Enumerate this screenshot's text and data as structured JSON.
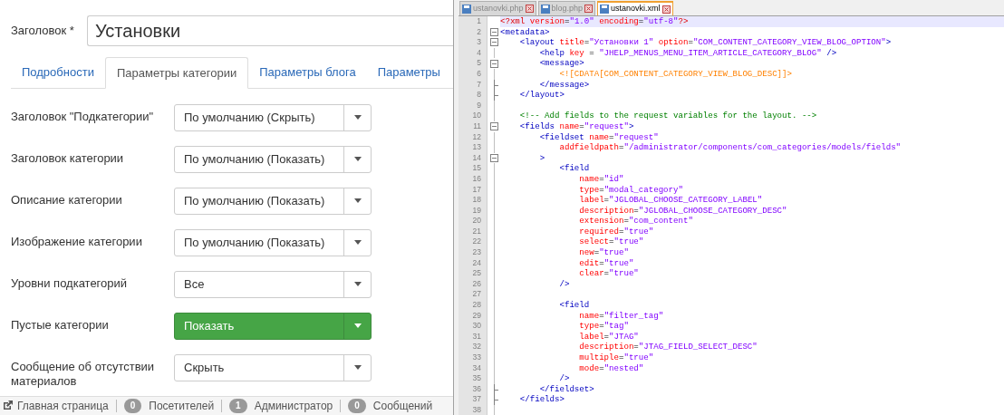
{
  "form": {
    "title_label": "Заголовок *",
    "title_value": "Установки",
    "tabs": [
      {
        "label": "Подробности",
        "selected": false
      },
      {
        "label": "Параметры категории",
        "selected": true
      },
      {
        "label": "Параметры блога",
        "selected": false
      },
      {
        "label": "Параметры",
        "selected": false
      }
    ],
    "rows": [
      {
        "label": "Заголовок \"Подкатегории\"",
        "value": "По умолчанию (Скрыть)",
        "success": false
      },
      {
        "label": "Заголовок категории",
        "value": "По умолчанию (Показать)",
        "success": false
      },
      {
        "label": "Описание категории",
        "value": "По умолчанию (Показать)",
        "success": false
      },
      {
        "label": "Изображение категории",
        "value": "По умолчанию (Показать)",
        "success": false
      },
      {
        "label": "Уровни подкатегорий",
        "value": "Все",
        "success": false
      },
      {
        "label": "Пустые категории",
        "value": "Показать",
        "success": true
      },
      {
        "label": "Сообщение об отсутствии материалов",
        "value": "Скрыть",
        "success": false
      }
    ]
  },
  "status_bar": {
    "home_link": "Главная страница",
    "items": [
      {
        "count": "0",
        "label": "Посетителей"
      },
      {
        "count": "1",
        "label": "Администратор"
      },
      {
        "count": "0",
        "label": "Сообщений"
      }
    ]
  },
  "editor": {
    "tabs": [
      {
        "label": "ustanovki.php",
        "selected": false
      },
      {
        "label": "blog.php",
        "selected": false
      },
      {
        "label": "ustanovki.xml",
        "selected": true
      }
    ],
    "lines": [
      {
        "number": "1",
        "current": true,
        "kind": "top",
        "tokens": [
          {
            "kind": "decl",
            "text": "<?xml "
          },
          {
            "kind": "attribute",
            "text": "version"
          },
          {
            "kind": "punct",
            "text": "="
          },
          {
            "kind": "value",
            "text": "\"1.0\" "
          },
          {
            "kind": "attribute",
            "text": "encoding"
          },
          {
            "kind": "punct",
            "text": "="
          },
          {
            "kind": "value",
            "text": "\"utf-8\""
          },
          {
            "kind": "decl",
            "text": "?>"
          }
        ]
      },
      {
        "number": "2",
        "current": false,
        "kind": "open",
        "tokens": [
          {
            "kind": "tag",
            "text": "<metadata>"
          }
        ]
      },
      {
        "number": "3",
        "current": false,
        "kind": "open",
        "tokens": [
          {
            "kind": "tag",
            "text": "    <layout "
          },
          {
            "kind": "attribute",
            "text": "title"
          },
          {
            "kind": "punct",
            "text": "="
          },
          {
            "kind": "value",
            "text": "\"Установки 1\" "
          },
          {
            "kind": "attribute",
            "text": "option"
          },
          {
            "kind": "punct",
            "text": "="
          },
          {
            "kind": "value",
            "text": "\"COM_CONTENT_CATEGORY_VIEW_BLOG_OPTION\""
          },
          {
            "kind": "tag",
            "text": ">"
          }
        ]
      },
      {
        "number": "4",
        "current": false,
        "kind": "inside",
        "tokens": [
          {
            "kind": "tag",
            "text": "        <help "
          },
          {
            "kind": "attribute",
            "text": "key"
          },
          {
            "kind": "punct",
            "text": " = "
          },
          {
            "kind": "value",
            "text": "\"JHELP_MENUS_MENU_ITEM_ARTICLE_CATEGORY_BLOG\""
          },
          {
            "kind": "tag",
            "text": " />"
          }
        ]
      },
      {
        "number": "5",
        "current": false,
        "kind": "open",
        "tokens": [
          {
            "kind": "tag",
            "text": "        <message>"
          }
        ]
      },
      {
        "number": "6",
        "current": false,
        "kind": "inside",
        "tokens": [
          {
            "kind": "cdata",
            "text": "            <![CDATA[COM_CONTENT_CATEGORY_VIEW_BLOG_DESC]]>"
          }
        ]
      },
      {
        "number": "7",
        "current": false,
        "kind": "close",
        "tokens": [
          {
            "kind": "tag",
            "text": "        </message>"
          }
        ]
      },
      {
        "number": "8",
        "current": false,
        "kind": "close",
        "tokens": [
          {
            "kind": "tag",
            "text": "    </layout>"
          }
        ]
      },
      {
        "number": "9",
        "current": false,
        "kind": "inside"
      },
      {
        "number": "10",
        "current": false,
        "kind": "inside",
        "tokens": [
          {
            "kind": "comment",
            "text": "    <!-- Add fields to the request variables for the layout. -->"
          }
        ]
      },
      {
        "number": "11",
        "current": false,
        "kind": "open",
        "tokens": [
          {
            "kind": "tag",
            "text": "    <fields "
          },
          {
            "kind": "attribute",
            "text": "name"
          },
          {
            "kind": "punct",
            "text": "="
          },
          {
            "kind": "value",
            "text": "\"request\""
          },
          {
            "kind": "tag",
            "text": ">"
          }
        ]
      },
      {
        "number": "12",
        "current": false,
        "kind": "inside",
        "tokens": [
          {
            "kind": "tag",
            "text": "        <fieldset "
          },
          {
            "kind": "attribute",
            "text": "name"
          },
          {
            "kind": "punct",
            "text": "="
          },
          {
            "kind": "value",
            "text": "\"request\""
          }
        ]
      },
      {
        "number": "13",
        "current": false,
        "kind": "inside",
        "tokens": [
          {
            "kind": "attribute",
            "text": "            addfieldpath"
          },
          {
            "kind": "punct",
            "text": "="
          },
          {
            "kind": "value",
            "text": "\"/administrator/components/com_categories/models/fields\""
          }
        ]
      },
      {
        "number": "14",
        "current": false,
        "kind": "open",
        "tokens": [
          {
            "kind": "tag",
            "text": "        >"
          }
        ]
      },
      {
        "number": "15",
        "current": false,
        "kind": "inside",
        "tokens": [
          {
            "kind": "tag",
            "text": "            <field"
          }
        ]
      },
      {
        "number": "16",
        "current": false,
        "kind": "inside",
        "tokens": [
          {
            "kind": "attribute",
            "text": "                name"
          },
          {
            "kind": "punct",
            "text": "="
          },
          {
            "kind": "value",
            "text": "\"id\""
          }
        ]
      },
      {
        "number": "17",
        "current": false,
        "kind": "inside",
        "tokens": [
          {
            "kind": "attribute",
            "text": "                type"
          },
          {
            "kind": "punct",
            "text": "="
          },
          {
            "kind": "value",
            "text": "\"modal_category\""
          }
        ]
      },
      {
        "number": "18",
        "current": false,
        "kind": "inside",
        "tokens": [
          {
            "kind": "attribute",
            "text": "                label"
          },
          {
            "kind": "punct",
            "text": "="
          },
          {
            "kind": "value",
            "text": "\"JGLOBAL_CHOOSE_CATEGORY_LABEL\""
          }
        ]
      },
      {
        "number": "19",
        "current": false,
        "kind": "inside",
        "tokens": [
          {
            "kind": "attribute",
            "text": "                description"
          },
          {
            "kind": "punct",
            "text": "="
          },
          {
            "kind": "value",
            "text": "\"JGLOBAL_CHOOSE_CATEGORY_DESC\""
          }
        ]
      },
      {
        "number": "20",
        "current": false,
        "kind": "inside",
        "tokens": [
          {
            "kind": "attribute",
            "text": "                extension"
          },
          {
            "kind": "punct",
            "text": "="
          },
          {
            "kind": "value",
            "text": "\"com_content\""
          }
        ]
      },
      {
        "number": "21",
        "current": false,
        "kind": "inside",
        "tokens": [
          {
            "kind": "attribute",
            "text": "                required"
          },
          {
            "kind": "punct",
            "text": "="
          },
          {
            "kind": "value",
            "text": "\"true\""
          }
        ]
      },
      {
        "number": "22",
        "current": false,
        "kind": "inside",
        "tokens": [
          {
            "kind": "attribute",
            "text": "                select"
          },
          {
            "kind": "punct",
            "text": "="
          },
          {
            "kind": "value",
            "text": "\"true\""
          }
        ]
      },
      {
        "number": "23",
        "current": false,
        "kind": "inside",
        "tokens": [
          {
            "kind": "attribute",
            "text": "                new"
          },
          {
            "kind": "punct",
            "text": "="
          },
          {
            "kind": "value",
            "text": "\"true\""
          }
        ]
      },
      {
        "number": "24",
        "current": false,
        "kind": "inside",
        "tokens": [
          {
            "kind": "attribute",
            "text": "                edit"
          },
          {
            "kind": "punct",
            "text": "="
          },
          {
            "kind": "value",
            "text": "\"true\""
          }
        ]
      },
      {
        "number": "25",
        "current": false,
        "kind": "inside",
        "tokens": [
          {
            "kind": "attribute",
            "text": "                clear"
          },
          {
            "kind": "punct",
            "text": "="
          },
          {
            "kind": "value",
            "text": "\"true\""
          }
        ]
      },
      {
        "number": "26",
        "current": false,
        "kind": "inside",
        "tokens": [
          {
            "kind": "tag",
            "text": "            />"
          }
        ]
      },
      {
        "number": "27",
        "current": false,
        "kind": "inside"
      },
      {
        "number": "28",
        "current": false,
        "kind": "inside",
        "tokens": [
          {
            "kind": "tag",
            "text": "            <field"
          }
        ]
      },
      {
        "number": "29",
        "current": false,
        "kind": "inside",
        "tokens": [
          {
            "kind": "attribute",
            "text": "                name"
          },
          {
            "kind": "punct",
            "text": "="
          },
          {
            "kind": "value",
            "text": "\"filter_tag\""
          }
        ]
      },
      {
        "number": "30",
        "current": false,
        "kind": "inside",
        "tokens": [
          {
            "kind": "attribute",
            "text": "                type"
          },
          {
            "kind": "punct",
            "text": "="
          },
          {
            "kind": "value",
            "text": "\"tag\""
          }
        ]
      },
      {
        "number": "31",
        "current": false,
        "kind": "inside",
        "tokens": [
          {
            "kind": "attribute",
            "text": "                label"
          },
          {
            "kind": "punct",
            "text": "="
          },
          {
            "kind": "value",
            "text": "\"JTAG\""
          }
        ]
      },
      {
        "number": "32",
        "current": false,
        "kind": "inside",
        "tokens": [
          {
            "kind": "attribute",
            "text": "                description"
          },
          {
            "kind": "punct",
            "text": "="
          },
          {
            "kind": "value",
            "text": "\"JTAG_FIELD_SELECT_DESC\""
          }
        ]
      },
      {
        "number": "33",
        "current": false,
        "kind": "inside",
        "tokens": [
          {
            "kind": "attribute",
            "text": "                multiple"
          },
          {
            "kind": "punct",
            "text": "="
          },
          {
            "kind": "value",
            "text": "\"true\""
          }
        ]
      },
      {
        "number": "34",
        "current": false,
        "kind": "inside",
        "tokens": [
          {
            "kind": "attribute",
            "text": "                mode"
          },
          {
            "kind": "punct",
            "text": "="
          },
          {
            "kind": "value",
            "text": "\"nested\""
          }
        ]
      },
      {
        "number": "35",
        "current": false,
        "kind": "inside",
        "tokens": [
          {
            "kind": "tag",
            "text": "            />"
          }
        ]
      },
      {
        "number": "36",
        "current": false,
        "kind": "close",
        "tokens": [
          {
            "kind": "tag",
            "text": "        </fieldset>"
          }
        ]
      },
      {
        "number": "37",
        "current": false,
        "kind": "close",
        "tokens": [
          {
            "kind": "tag",
            "text": "    </fields>"
          }
        ]
      },
      {
        "number": "38",
        "current": false,
        "kind": "inside"
      }
    ]
  }
}
